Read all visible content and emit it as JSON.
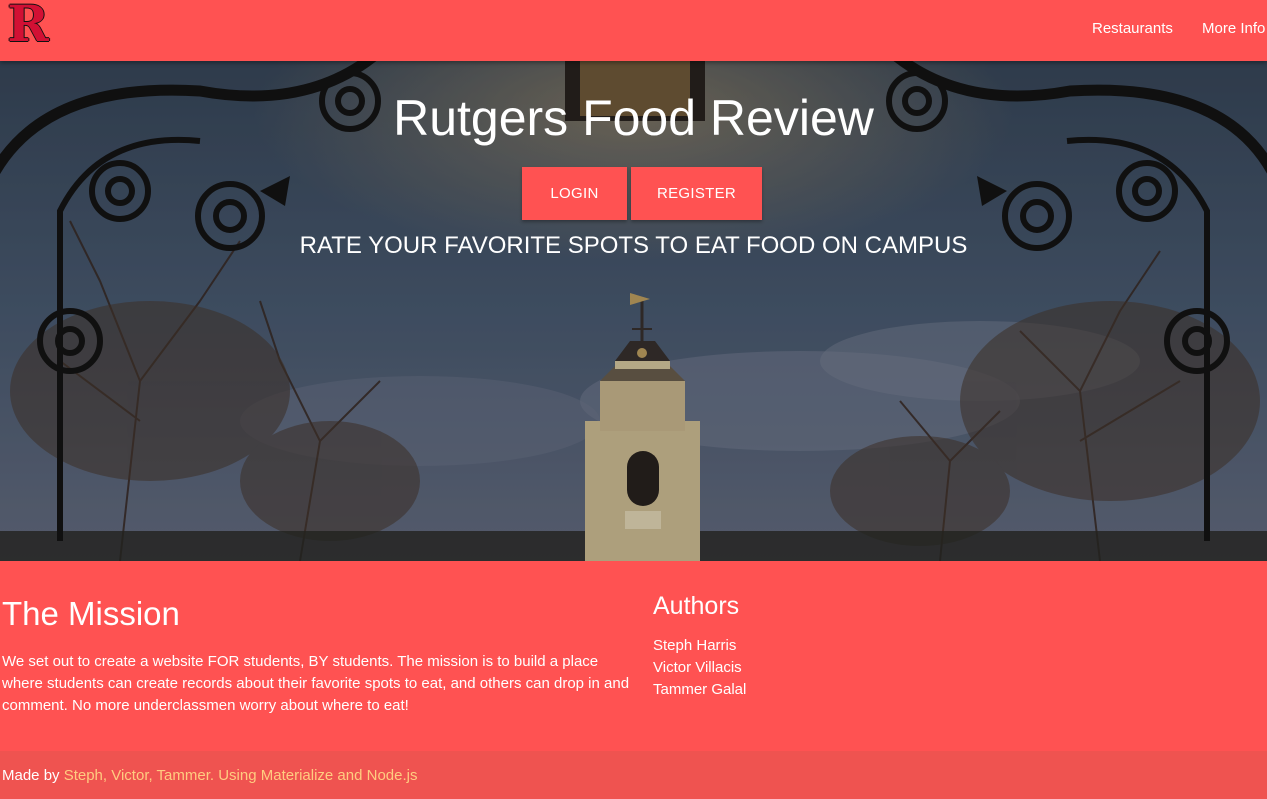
{
  "nav": {
    "logo_letter": "R",
    "links": [
      "Restaurants",
      "More Info"
    ]
  },
  "hero": {
    "title": "Rutgers Food Review",
    "login_label": "LOGIN",
    "register_label": "REGISTER",
    "tagline": "RATE YOUR FAVORITE SPOTS TO EAT FOOD ON CAMPUS"
  },
  "mission": {
    "title": "The Mission",
    "text": "We set out to create a website FOR students, BY students. The mission is to build a place where students can create records about their favorite spots to eat, and others can drop in and comment. No more underclassmen worry about where to eat!"
  },
  "authors": {
    "title": "Authors",
    "names": [
      "Steph Harris",
      "Victor Villacis",
      "Tammer Galal"
    ]
  },
  "footer": {
    "prefix": "Made by ",
    "credit": "Steph, Victor, Tammer. Using Materialize and Node.js"
  },
  "colors": {
    "accent": "#ff5252",
    "footer": "#ef5350",
    "credit_link": "#ffcc80",
    "logo": "#d21034"
  },
  "icons": {
    "logo": "rutgers-r-logo"
  }
}
